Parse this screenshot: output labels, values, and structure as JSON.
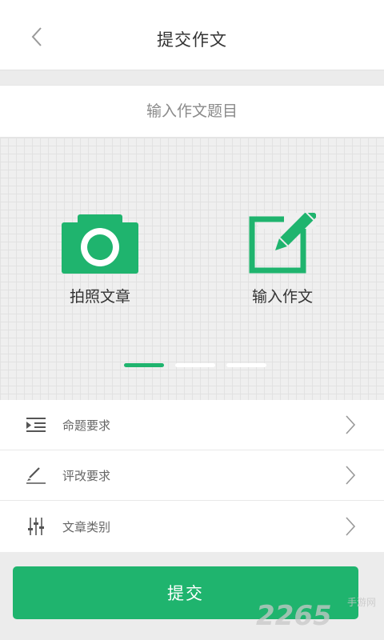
{
  "header": {
    "title": "提交作文",
    "back_icon": "chevron-left-icon"
  },
  "topic": {
    "placeholder": "输入作文题目",
    "value": ""
  },
  "options": [
    {
      "label": "拍照文章",
      "icon": "camera-icon"
    },
    {
      "label": "输入作文",
      "icon": "edit-icon"
    }
  ],
  "pager": {
    "count": 3,
    "active_index": 0
  },
  "settings": [
    {
      "label": "命题要求",
      "icon": "indent-list-icon"
    },
    {
      "label": "评改要求",
      "icon": "pen-icon"
    },
    {
      "label": "文章类别",
      "icon": "sliders-icon"
    }
  ],
  "submit": {
    "label": "提交"
  },
  "colors": {
    "accent": "#1fb46e",
    "background": "#ececec",
    "text": "#333333"
  },
  "watermark": {
    "number": "2265",
    "text": "手游网"
  }
}
